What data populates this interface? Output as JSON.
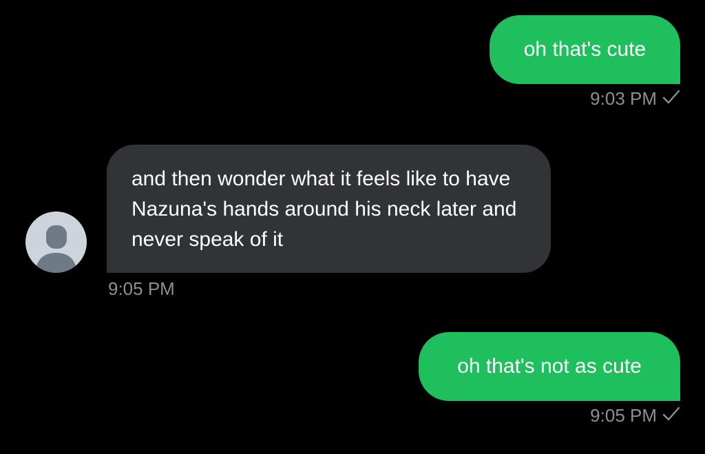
{
  "messages": [
    {
      "direction": "sent",
      "text": "oh that's cute",
      "time": "9:03 PM",
      "status_icon": "check-icon"
    },
    {
      "direction": "received",
      "text": "and then wonder what it feels like to have Nazuna's hands around his neck later and never speak of it",
      "time": "9:05 PM",
      "avatar_icon": "default-person-icon"
    },
    {
      "direction": "sent",
      "text": "oh that's not as cute",
      "time": "9:05 PM",
      "status_icon": "check-icon"
    }
  ],
  "colors": {
    "background": "#000000",
    "sent_bubble": "#1fbf5e",
    "received_bubble": "#313336",
    "timestamp": "#8e8f93",
    "avatar_bg": "#cdd4dc",
    "avatar_figure": "#6e7a86"
  }
}
